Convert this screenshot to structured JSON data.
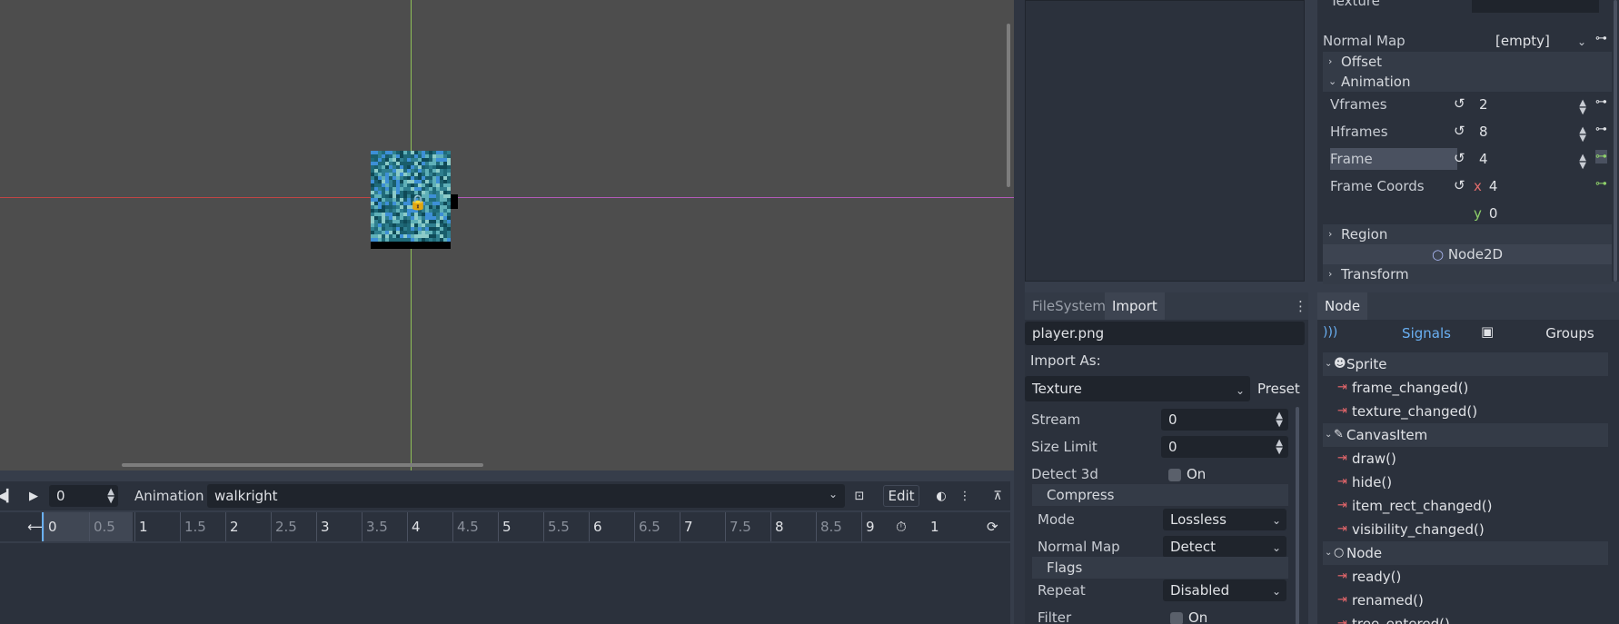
{
  "viewport": {
    "sprite": "player-sprite"
  },
  "animation_bar": {
    "time_value": "0",
    "animation_label": "Animation",
    "current_animation": "walkright",
    "edit_label": "Edit"
  },
  "timeline": {
    "ticks": [
      "0",
      "0.5",
      "1",
      "1.5",
      "2",
      "2.5",
      "3",
      "3.5",
      "4",
      "4.5",
      "5",
      "5.5",
      "6",
      "6.5",
      "7",
      "7.5",
      "8",
      "8.5",
      "9"
    ],
    "length_value": "1"
  },
  "inspector": {
    "texture_label": "Texture",
    "normal_map_label": "Normal Map",
    "normal_map_value": "[empty]",
    "offset_section": "Offset",
    "animation_section": "Animation",
    "vframes_label": "Vframes",
    "vframes_value": "2",
    "hframes_label": "Hframes",
    "hframes_value": "8",
    "frame_label": "Frame",
    "frame_value": "4",
    "frame_coords_label": "Frame Coords",
    "frame_coords_x_label": "x",
    "frame_coords_x": "4",
    "frame_coords_y_label": "y",
    "frame_coords_y": "0",
    "region_section": "Region",
    "node2d_category": "Node2D",
    "transform_section": "Transform"
  },
  "import_dock": {
    "tabs": [
      "FileSystem",
      "Import"
    ],
    "active_tab": "Import",
    "file_name": "player.png",
    "import_as_label": "Import As:",
    "import_as_value": "Texture",
    "preset_label": "Preset",
    "stream_label": "Stream",
    "stream_value": "0",
    "size_limit_label": "Size Limit",
    "size_limit_value": "0",
    "detect_3d_label": "Detect 3d",
    "detect_3d_value": "On",
    "compress_section": "Compress",
    "mode_label": "Mode",
    "mode_value": "Lossless",
    "normal_map_label": "Normal Map",
    "normal_map_value": "Detect",
    "flags_section": "Flags",
    "repeat_label": "Repeat",
    "repeat_value": "Disabled",
    "filter_label": "Filter",
    "filter_value": "On"
  },
  "node_dock": {
    "tab": "Node",
    "signals_label": "Signals",
    "groups_label": "Groups",
    "classes": [
      {
        "name": "Sprite",
        "signals": [
          "frame_changed()",
          "texture_changed()"
        ]
      },
      {
        "name": "CanvasItem",
        "signals": [
          "draw()",
          "hide()",
          "item_rect_changed()",
          "visibility_changed()"
        ]
      },
      {
        "name": "Node",
        "signals": [
          "ready()",
          "renamed()",
          "tree_entered()"
        ]
      }
    ]
  },
  "colors": {
    "accent": "#6ab0f3",
    "signal_icon": "#e9676c",
    "x_axis": "#c04545",
    "y_axis": "#8fbf58"
  }
}
